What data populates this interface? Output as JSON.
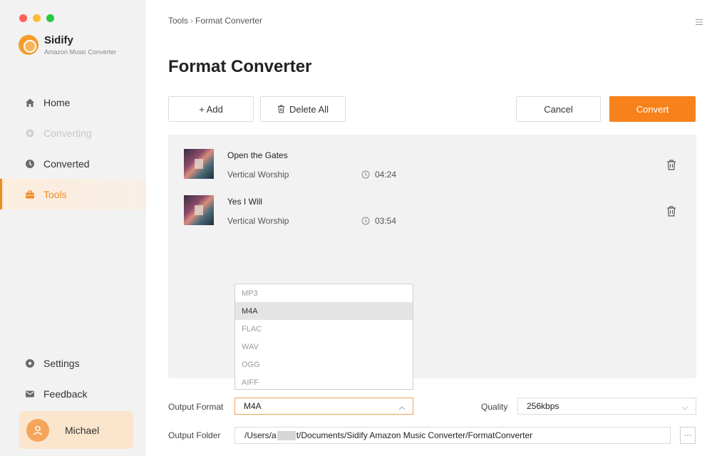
{
  "app": {
    "name": "Sidify",
    "subtitle": "Amazon Music Converter"
  },
  "sidebar": {
    "items": [
      {
        "label": "Home",
        "icon": "home-icon",
        "state": "normal"
      },
      {
        "label": "Converting",
        "icon": "converting-icon",
        "state": "disabled"
      },
      {
        "label": "Converted",
        "icon": "clock-icon",
        "state": "normal"
      },
      {
        "label": "Tools",
        "icon": "toolbox-icon",
        "state": "active"
      }
    ],
    "bottom_items": [
      {
        "label": "Settings",
        "icon": "gear-icon"
      },
      {
        "label": "Feedback",
        "icon": "mail-icon"
      }
    ],
    "user": {
      "name": "Michael"
    }
  },
  "breadcrumb": {
    "parent": "Tools",
    "separator": "›",
    "current": "Format Converter"
  },
  "page": {
    "title": "Format Converter"
  },
  "toolbar": {
    "add_label": "+ Add",
    "delete_all_label": "Delete All",
    "cancel_label": "Cancel",
    "convert_label": "Convert"
  },
  "tracks": [
    {
      "title": "Open the Gates",
      "artist": "Vertical Worship",
      "duration": "04:24"
    },
    {
      "title": "Yes I Will",
      "artist": "Vertical Worship",
      "duration": "03:54"
    }
  ],
  "output": {
    "format_label": "Output Format",
    "format_value": "M4A",
    "format_options": [
      "MP3",
      "M4A",
      "FLAC",
      "WAV",
      "OGG",
      "AIFF"
    ],
    "quality_label": "Quality",
    "quality_value": "256kbps",
    "folder_label": "Output Folder",
    "folder_prefix": "/Users/a",
    "folder_suffix": "t/Documents/Sidify Amazon Music Converter/FormatConverter",
    "browse_label": "···"
  },
  "colors": {
    "accent": "#f7821b",
    "sidebar_bg": "#f2f2f2",
    "panel_bg": "#f2f2f2",
    "active_nav": "#f08a24"
  }
}
